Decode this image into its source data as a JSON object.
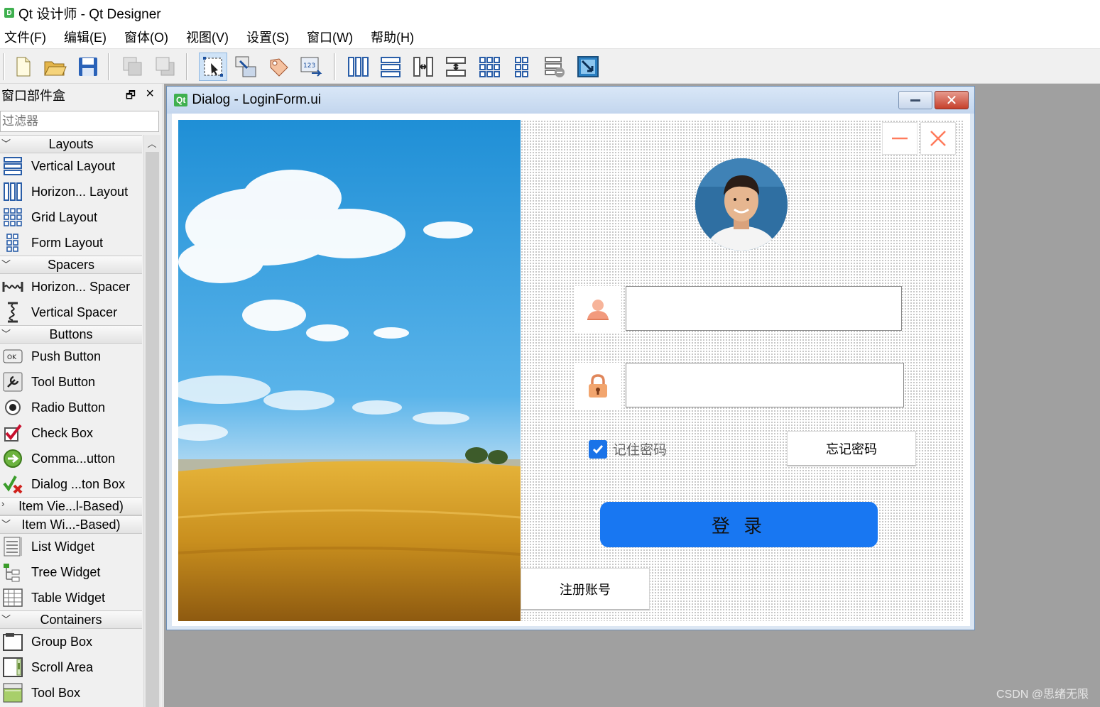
{
  "app": {
    "title": "Qt 设计师 - Qt Designer",
    "icon_label": "D"
  },
  "menu": [
    "文件(F)",
    "编辑(E)",
    "窗体(O)",
    "视图(V)",
    "设置(S)",
    "窗口(W)",
    "帮助(H)"
  ],
  "toolbar": {
    "buttons": [
      "new-icon",
      "open-icon",
      "save-icon",
      "send-to-back-icon",
      "bring-to-front-icon",
      "edit-widgets-icon",
      "edit-signals-slots-icon",
      "edit-buddies-icon",
      "edit-tab-order-icon",
      "layout-horizontal-icon",
      "layout-vertical-icon",
      "layout-h-splitter-icon",
      "layout-v-splitter-icon",
      "layout-grid-icon",
      "layout-form-icon",
      "break-layout-icon",
      "adjust-size-icon"
    ],
    "active": "edit-widgets-icon"
  },
  "widget_box": {
    "title": "窗口部件盒",
    "filter_placeholder": "过滤器",
    "sections": [
      {
        "label": "Layouts",
        "expanded": true,
        "items": [
          {
            "label": "Vertical Layout",
            "icon": "vertical-layout-icon"
          },
          {
            "label": "Horizon... Layout",
            "icon": "horizontal-layout-icon"
          },
          {
            "label": "Grid Layout",
            "icon": "grid-layout-icon"
          },
          {
            "label": "Form Layout",
            "icon": "form-layout-icon"
          }
        ]
      },
      {
        "label": "Spacers",
        "expanded": true,
        "items": [
          {
            "label": "Horizon... Spacer",
            "icon": "horizontal-spacer-icon"
          },
          {
            "label": "Vertical Spacer",
            "icon": "vertical-spacer-icon"
          }
        ]
      },
      {
        "label": "Buttons",
        "expanded": true,
        "items": [
          {
            "label": "Push Button",
            "icon": "push-button-icon"
          },
          {
            "label": "Tool Button",
            "icon": "tool-button-icon"
          },
          {
            "label": "Radio Button",
            "icon": "radio-button-icon"
          },
          {
            "label": "Check Box",
            "icon": "check-box-icon"
          },
          {
            "label": "Comma...utton",
            "icon": "command-link-icon"
          },
          {
            "label": "Dialog ...ton Box",
            "icon": "dialog-button-box-icon"
          }
        ]
      },
      {
        "label": "Item Vie...l-Based)",
        "expanded": false,
        "items": []
      },
      {
        "label": "Item Wi...-Based)",
        "expanded": true,
        "items": [
          {
            "label": "List Widget",
            "icon": "list-widget-icon"
          },
          {
            "label": "Tree Widget",
            "icon": "tree-widget-icon"
          },
          {
            "label": "Table Widget",
            "icon": "table-widget-icon"
          }
        ]
      },
      {
        "label": "Containers",
        "expanded": true,
        "items": [
          {
            "label": "Group Box",
            "icon": "group-box-icon"
          },
          {
            "label": "Scroll Area",
            "icon": "scroll-area-icon"
          },
          {
            "label": "Tool Box",
            "icon": "tool-box-icon"
          }
        ]
      }
    ]
  },
  "dialog": {
    "badge": "Qt",
    "title": "Dialog - LoginForm.ui",
    "form": {
      "username_value": "",
      "password_value": "",
      "remember_label": "记住密码",
      "remember_checked": true,
      "forgot_label": "忘记密码",
      "login_label": "登 录",
      "register_label": "注册账号"
    }
  },
  "watermark": "CSDN @思绪无限",
  "colors": {
    "accent": "#1877f2",
    "qt_green": "#3fb04f",
    "close_red": "#ff7b5c"
  }
}
